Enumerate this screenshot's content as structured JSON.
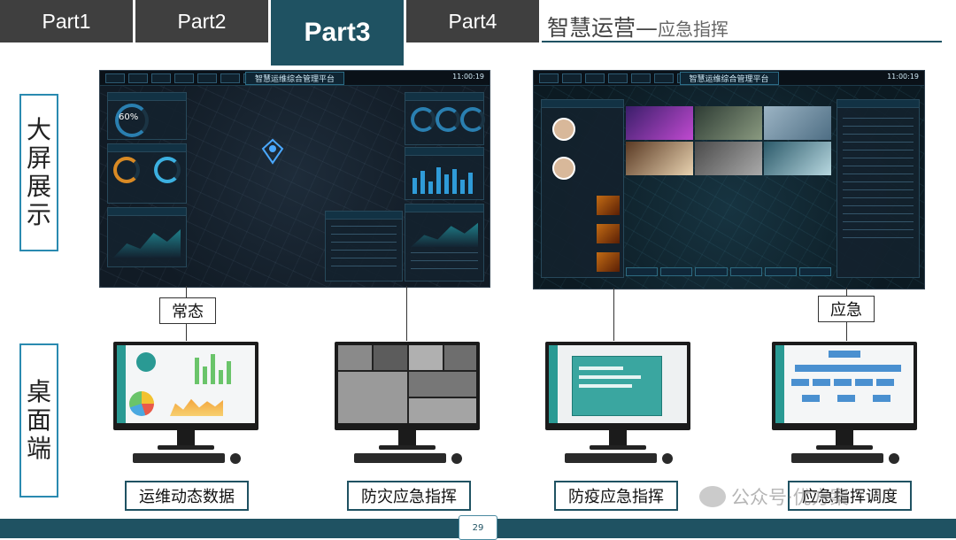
{
  "tabs": [
    "Part1",
    "Part2",
    "Part3",
    "Part4"
  ],
  "active_tab": "Part3",
  "title": {
    "main": "智慧运营—",
    "sub": "应急指挥"
  },
  "sections": {
    "big_screen": [
      "大",
      "屏",
      "展",
      "示"
    ],
    "desktop": [
      "桌",
      "面",
      "端"
    ]
  },
  "modes": {
    "normal": "常态",
    "emergency": "应急"
  },
  "screens": {
    "left": {
      "title": "智慧运维综合管理平台",
      "time": "11:00:19"
    },
    "right": {
      "title": "智慧运维综合管理平台",
      "time": "11:00:19"
    }
  },
  "left_screen_metric": "60%",
  "captions": [
    "运维动态数据",
    "防灾应急指挥",
    "防疫应急指挥",
    "应急指挥调度"
  ],
  "watermark": "公众号·优方案",
  "page_number": "29"
}
